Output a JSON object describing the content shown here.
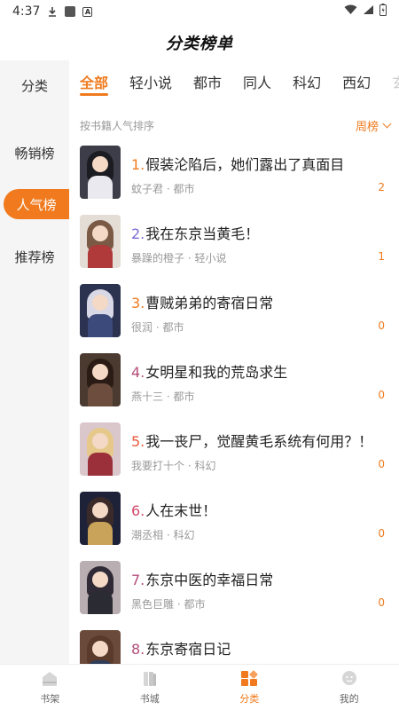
{
  "status_bar": {
    "time": "4:37"
  },
  "header": {
    "title": "分类榜单"
  },
  "sidebar": {
    "items": [
      {
        "label": "分类",
        "active": false
      },
      {
        "label": "畅销榜",
        "active": false
      },
      {
        "label": "人气榜",
        "active": true
      },
      {
        "label": "推荐榜",
        "active": false
      }
    ]
  },
  "tabs": [
    {
      "label": "全部",
      "active": true
    },
    {
      "label": "轻小说",
      "active": false
    },
    {
      "label": "都市",
      "active": false
    },
    {
      "label": "同人",
      "active": false
    },
    {
      "label": "科幻",
      "active": false
    },
    {
      "label": "西幻",
      "active": false
    },
    {
      "label": "玄",
      "active": false
    }
  ],
  "sort": {
    "label": "按书籍人气排序",
    "selected": "周榜"
  },
  "books": [
    {
      "rank": "1.",
      "title": "假装沦陷后，她们露出了真面目",
      "meta": "蚊子君 · 都市",
      "count": "2"
    },
    {
      "rank": "2.",
      "title": "我在东京当黄毛！",
      "meta": "暴躁的橙子 · 轻小说",
      "count": "1"
    },
    {
      "rank": "3.",
      "title": "曹贼弟弟的寄宿日常",
      "meta": "很润 · 都市",
      "count": "0"
    },
    {
      "rank": "4.",
      "title": "女明星和我的荒岛求生",
      "meta": "燕十三 · 都市",
      "count": "0"
    },
    {
      "rank": "5.",
      "title": "我一丧尸，觉醒黄毛系统有何用？！",
      "meta": "我要打十个 · 科幻",
      "count": "0"
    },
    {
      "rank": "6.",
      "title": "人在末世！",
      "meta": "潮丞相 · 科幻",
      "count": "0"
    },
    {
      "rank": "7.",
      "title": "东京中医的幸福日常",
      "meta": "黑色巨雕 · 都市",
      "count": "0"
    },
    {
      "rank": "8.",
      "title": "东京寄宿日记",
      "meta": "",
      "count": ""
    }
  ],
  "rank_colors": [
    "#f07a1d",
    "#7b6ad8",
    "#f07a1d",
    "#b34f7a",
    "#e85a3c",
    "#d54a6b",
    "#b34f7a",
    "#b34f7a"
  ],
  "cover_colors": [
    {
      "bg": "#3d3d4a",
      "hair": "#1b1b22",
      "body": "#e9e9ef"
    },
    {
      "bg": "#e4ddd6",
      "hair": "#7a5a45",
      "body": "#b03a3a"
    },
    {
      "bg": "#2b3350",
      "hair": "#d8d8e6",
      "body": "#3b4a7a"
    },
    {
      "bg": "#4a3a30",
      "hair": "#2a1c14",
      "body": "#6d4e3e"
    },
    {
      "bg": "#d9c7cc",
      "hair": "#e6c98a",
      "body": "#9b2f3a"
    },
    {
      "bg": "#1e2238",
      "hair": "#3a2a2a",
      "body": "#c9a35a"
    },
    {
      "bg": "#b9aeb2",
      "hair": "#2f2a35",
      "body": "#2b2b33"
    },
    {
      "bg": "#6a4a3a",
      "hair": "#5a3a2a",
      "body": "#2f3d5a"
    }
  ],
  "bottom_nav": [
    {
      "label": "书架",
      "icon": "bookshelf-icon",
      "active": false
    },
    {
      "label": "书城",
      "icon": "bookstore-icon",
      "active": false
    },
    {
      "label": "分类",
      "icon": "category-icon",
      "active": true
    },
    {
      "label": "我的",
      "icon": "profile-icon",
      "active": false
    }
  ],
  "accent_color": "#f07a1d"
}
